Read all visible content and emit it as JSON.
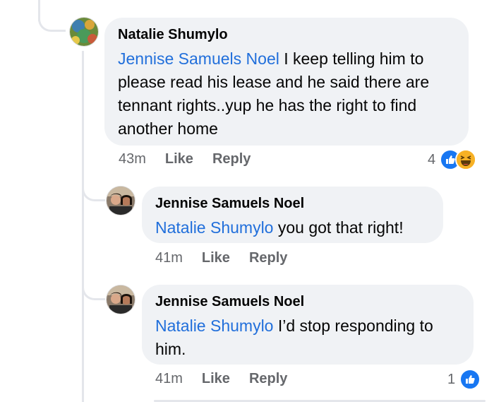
{
  "comments": [
    {
      "author": "Natalie Shumylo",
      "mention": "Jennise Samuels Noel",
      "text": " I keep telling  him to please read his lease and he said there are tennant rights..yup he has the right  to find another  home",
      "time": "43m",
      "like_label": "Like",
      "reply_label": "Reply",
      "reaction_count": "4"
    },
    {
      "author": "Jennise Samuels Noel",
      "mention": "Natalie Shumylo",
      "text": " you got that right!",
      "time": "41m",
      "like_label": "Like",
      "reply_label": "Reply"
    },
    {
      "author": "Jennise Samuels Noel",
      "mention": "Natalie Shumylo",
      "text": " I’d stop responding to him.",
      "time": "41m",
      "like_label": "Like",
      "reply_label": "Reply",
      "reaction_count": "1"
    }
  ],
  "colors": {
    "mention": "#216fdb",
    "bubble": "#f0f2f5",
    "like": "#1877f2",
    "haha": "#f7b125"
  },
  "icons": [
    "like-reaction-icon",
    "haha-reaction-icon"
  ]
}
